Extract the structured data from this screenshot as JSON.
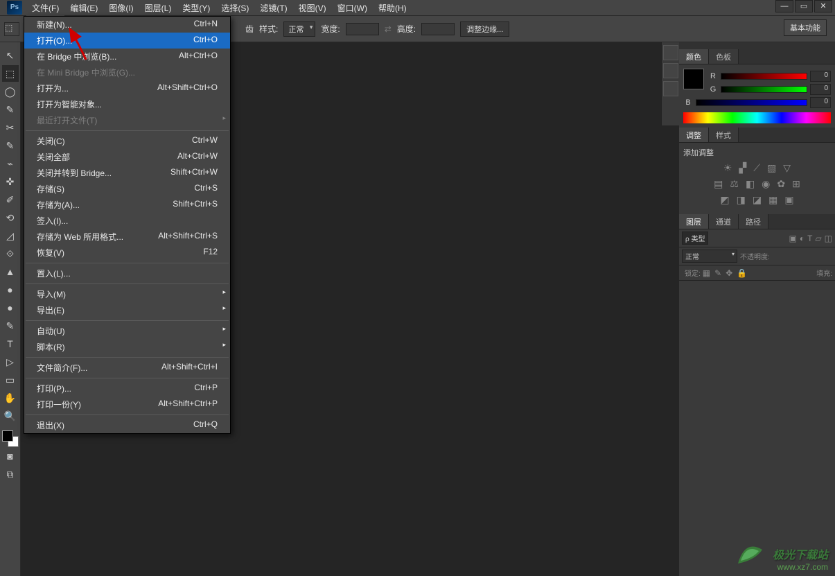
{
  "app": {
    "logo": "Ps"
  },
  "menubar": [
    "文件(F)",
    "编辑(E)",
    "图像(I)",
    "图层(L)",
    "类型(Y)",
    "选择(S)",
    "滤镜(T)",
    "视图(V)",
    "窗口(W)",
    "帮助(H)"
  ],
  "options": {
    "antialias_suffix": "齿",
    "style_label": "样式:",
    "style_value": "正常",
    "width_label": "宽度:",
    "height_label": "高度:",
    "refine": "调整边缘...",
    "workspace": "基本功能"
  },
  "filemenu": [
    {
      "t": "item",
      "label": "新建(N)...",
      "short": "Ctrl+N"
    },
    {
      "t": "item",
      "label": "打开(O)...",
      "short": "Ctrl+O",
      "hl": true
    },
    {
      "t": "item",
      "label": "在 Bridge 中浏览(B)...",
      "short": "Alt+Ctrl+O"
    },
    {
      "t": "item",
      "label": "在 Mini Bridge 中浏览(G)...",
      "short": "",
      "dis": true
    },
    {
      "t": "item",
      "label": "打开为...",
      "short": "Alt+Shift+Ctrl+O"
    },
    {
      "t": "item",
      "label": "打开为智能对象...",
      "short": ""
    },
    {
      "t": "item",
      "label": "最近打开文件(T)",
      "short": "",
      "sub": true,
      "dis": true
    },
    {
      "t": "sep"
    },
    {
      "t": "item",
      "label": "关闭(C)",
      "short": "Ctrl+W"
    },
    {
      "t": "item",
      "label": "关闭全部",
      "short": "Alt+Ctrl+W"
    },
    {
      "t": "item",
      "label": "关闭并转到 Bridge...",
      "short": "Shift+Ctrl+W"
    },
    {
      "t": "item",
      "label": "存储(S)",
      "short": "Ctrl+S"
    },
    {
      "t": "item",
      "label": "存储为(A)...",
      "short": "Shift+Ctrl+S"
    },
    {
      "t": "item",
      "label": "签入(I)...",
      "short": ""
    },
    {
      "t": "item",
      "label": "存储为 Web 所用格式...",
      "short": "Alt+Shift+Ctrl+S"
    },
    {
      "t": "item",
      "label": "恢复(V)",
      "short": "F12"
    },
    {
      "t": "sep"
    },
    {
      "t": "item",
      "label": "置入(L)...",
      "short": ""
    },
    {
      "t": "sep"
    },
    {
      "t": "item",
      "label": "导入(M)",
      "short": "",
      "sub": true
    },
    {
      "t": "item",
      "label": "导出(E)",
      "short": "",
      "sub": true
    },
    {
      "t": "sep"
    },
    {
      "t": "item",
      "label": "自动(U)",
      "short": "",
      "sub": true
    },
    {
      "t": "item",
      "label": "脚本(R)",
      "short": "",
      "sub": true
    },
    {
      "t": "sep"
    },
    {
      "t": "item",
      "label": "文件简介(F)...",
      "short": "Alt+Shift+Ctrl+I"
    },
    {
      "t": "sep"
    },
    {
      "t": "item",
      "label": "打印(P)...",
      "short": "Ctrl+P"
    },
    {
      "t": "item",
      "label": "打印一份(Y)",
      "short": "Alt+Shift+Ctrl+P"
    },
    {
      "t": "sep"
    },
    {
      "t": "item",
      "label": "退出(X)",
      "short": "Ctrl+Q"
    }
  ],
  "tools": [
    "↖",
    "⬚",
    "◯",
    "✎",
    "✂",
    "✎",
    "⌁",
    "✜",
    "✐",
    "⟲",
    "◿",
    "⟐",
    "▲",
    "●",
    "●",
    "✎",
    "T",
    "▷",
    "▭",
    "✋",
    "🔍"
  ],
  "color": {
    "tab_color": "颜色",
    "tab_swatches": "色板",
    "r": "R",
    "g": "G",
    "b": "B",
    "r_val": "0",
    "g_val": "0",
    "b_val": "0"
  },
  "adjust": {
    "tab_adjust": "调整",
    "tab_styles": "样式",
    "add": "添加调整"
  },
  "layers": {
    "tab_layers": "图层",
    "tab_channels": "通道",
    "tab_paths": "路径",
    "kind": "ρ 类型",
    "normal": "正常",
    "opacity": "不透明度:",
    "lock": "锁定:",
    "fill": "填充:"
  },
  "watermark": {
    "line1": "极光下载站",
    "line2": "www.xz7.com"
  }
}
